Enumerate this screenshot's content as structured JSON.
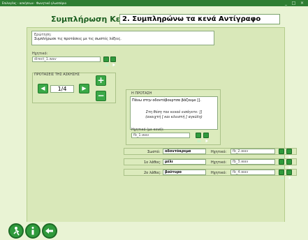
{
  "window": {
    "title": "Επιλογέας - ασκήσεων · Φωνητικό γλωσσάριο",
    "close": "×",
    "maximize": "□",
    "minimize": "_"
  },
  "header": {
    "label": "Συμπλήρωση Κενών:",
    "title": "2. Συμπληρώνω τα κενά Αντίγραφο"
  },
  "question": {
    "label": "Ερώτηση:",
    "text": "Συμπλήρωσε τις προτάσεις με τις σωστές λέξεις."
  },
  "sound": {
    "label": "Ηχητικό:",
    "file": "direct_1.wav"
  },
  "proposals": {
    "label": "ΠΡΟΤΑΣΕΙΣ ΤΗΣ ΑΣΚΗΣΗΣ",
    "counter": "1/4",
    "plus": "+",
    "minus": "−",
    "prev": "◀",
    "next": "▶"
  },
  "sentence": {
    "label": "Η ΠΡΟΤΑΣΗ",
    "text": "Πάνω στην οδοντόβουρτσα βάζουμε [].",
    "hint_line1": "Στη θέση του κενού εισάγετε: []",
    "hint_line2": "(ανοιχτή [ και κλειστή ] αγκύλη)",
    "sound_label": "Ηχητικό (με κενό):",
    "sound_file": "fb_1.wav"
  },
  "answers": [
    {
      "label": "Σωστό:",
      "value": "οδοντόκρεμα",
      "sound_label": "Ηχητικό:",
      "sound_file": "fb_2.wav"
    },
    {
      "label": "1ο λάθος:",
      "value": "μέλι",
      "sound_label": "Ηχητικό:",
      "sound_file": "fb_3.wav"
    },
    {
      "label": "2ο λάθος:",
      "value": "βούτυρο",
      "sound_label": "Ηχητικό:",
      "sound_file": "fb_4.wav"
    }
  ],
  "colors": {
    "accent": "#2f9a3c",
    "background": "#e9f3d4",
    "panel": "#d9e8b9"
  },
  "icons": {
    "play": "play-icon",
    "folder": "folder-icon",
    "exit": "exit-icon",
    "info": "info-icon",
    "back": "back-arrow-icon"
  }
}
